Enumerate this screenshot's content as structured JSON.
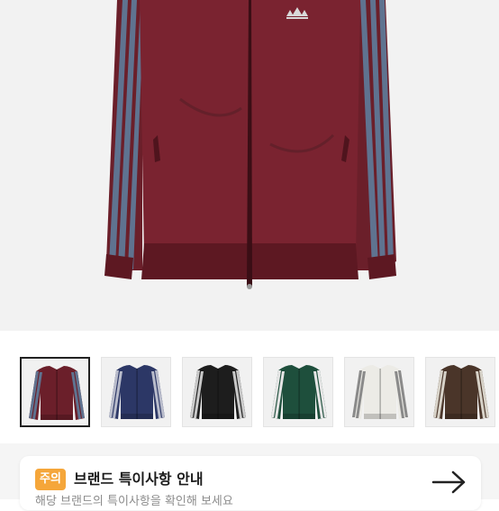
{
  "product": {
    "images": [
      {
        "name": "burgundy",
        "body": "#6b1f2a",
        "stripe": "#5f7390",
        "selected": true
      },
      {
        "name": "navy",
        "body": "#2c3766",
        "stripe": "#b9bccb",
        "selected": false
      },
      {
        "name": "black",
        "body": "#1d1d1d",
        "stripe": "#c9c9c9",
        "selected": false
      },
      {
        "name": "green",
        "body": "#1e4f3c",
        "stripe": "#e6e6e6",
        "selected": false
      },
      {
        "name": "white",
        "body": "#ecebe6",
        "stripe": "#8a8a8a",
        "selected": false
      },
      {
        "name": "brown",
        "body": "#4a3529",
        "stripe": "#d7d2c8",
        "selected": false
      }
    ]
  },
  "notice": {
    "badge": "주의",
    "title": "브랜드 특이사항 안내",
    "subtitle": "해당 브랜드의 특이사항을 확인해 보세요",
    "arrow_icon": "arrow-right-icon"
  }
}
